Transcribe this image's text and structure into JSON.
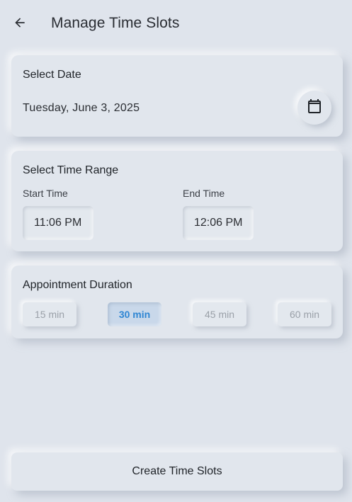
{
  "header": {
    "title": "Manage Time Slots",
    "back_icon": "arrow-left-icon"
  },
  "date_card": {
    "title": "Select Date",
    "value": "Tuesday, June 3, 2025",
    "calendar_icon": "calendar-icon"
  },
  "time_card": {
    "title": "Select Time Range",
    "start_label": "Start Time",
    "start_value": "11:06 PM",
    "end_label": "End Time",
    "end_value": "12:06 PM"
  },
  "duration_card": {
    "title": "Appointment Duration",
    "options": [
      {
        "label": "15 min",
        "selected": false
      },
      {
        "label": "30 min",
        "selected": true
      },
      {
        "label": "45 min",
        "selected": false
      },
      {
        "label": "60 min",
        "selected": false
      }
    ]
  },
  "create_button": {
    "label": "Create Time Slots"
  },
  "colors": {
    "background": "#dfe4ec",
    "accent": "#2f86d3",
    "selected_chip_bg": "#c9d8ea"
  }
}
